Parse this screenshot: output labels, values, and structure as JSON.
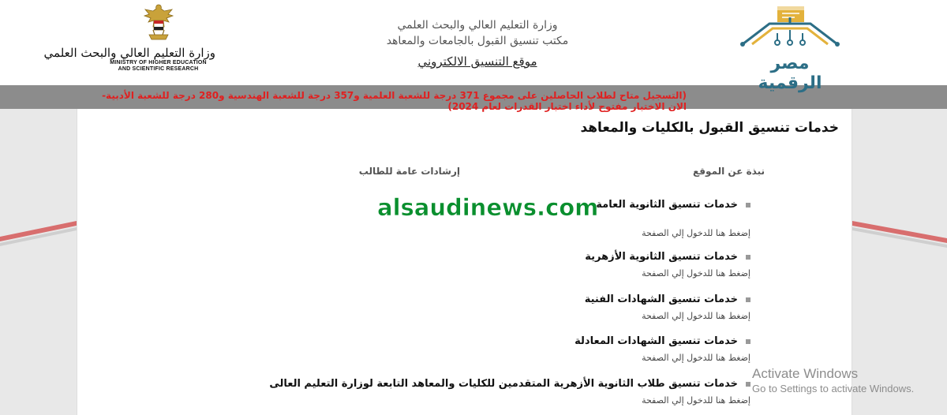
{
  "header": {
    "ministry_arabic": "وزارة التعليم العالي والبحث العلمي",
    "ministry_english_line1": "MINISTRY OF HIGHER EDUCATION",
    "ministry_english_line2": "AND SCIENTIFIC RESEARCH",
    "center_line1": "وزارة التعليم العالي والبحث العلمي",
    "center_line2": "مكتب تنسيق القبول بالجامعات والمعاهد",
    "center_link": "موقع التنسيق الالكتروني",
    "digital_egypt_logo_text": "مصر الرقمية"
  },
  "main": {
    "page_title": "خدمات تنسيق القبول بالكليات والمعاهد",
    "column_about": "نبذة عن الموقع",
    "column_guidance": "إرشادات عامة للطالب",
    "alert_text": "(التسجيل متاح لطلاب الحاصلين على مجموع 371 درجة للشعبة العلمية و357 درجة للشعبة الهندسية و280 درجة للشعبة الأدبية-الان الاختبار مفتوح لأداء اختبار القدرات لعام 2024)",
    "services": [
      {
        "name": "خدمات تنسيق الثانوية العامة",
        "link": "إضغط هنا للدخول إلي الصفحة"
      },
      {
        "name": "خدمات تنسيق الثانوية الأزهرية",
        "link": "إضغط هنا للدخول إلي الصفحة"
      },
      {
        "name": "خدمات تنسيق الشهادات الفنية",
        "link": "إضغط هنا للدخول إلي الصفحة"
      },
      {
        "name": "خدمات تنسيق الشهادات المعادلة",
        "link": "إضغط هنا للدخول إلي الصفحة"
      },
      {
        "name": "خدمات تنسيق طلاب الثانوية الأزهرية المتقدمين للكليات والمعاهد التابعة لوزارة التعليم العالى",
        "link": "إضغط هنا للدخول إلي الصفحة"
      }
    ]
  },
  "overlay": {
    "watermark": "alsaudinews.com",
    "activate_title": "Activate Windows",
    "activate_sub": "Go to Settings to activate Windows."
  },
  "colors": {
    "alert_red": "#e02020",
    "watermark_green": "#0a8f2e",
    "header_bar_gray": "#8c8c8c",
    "logo_blue": "#2c6e86",
    "logo_gold": "#e3b23c"
  }
}
